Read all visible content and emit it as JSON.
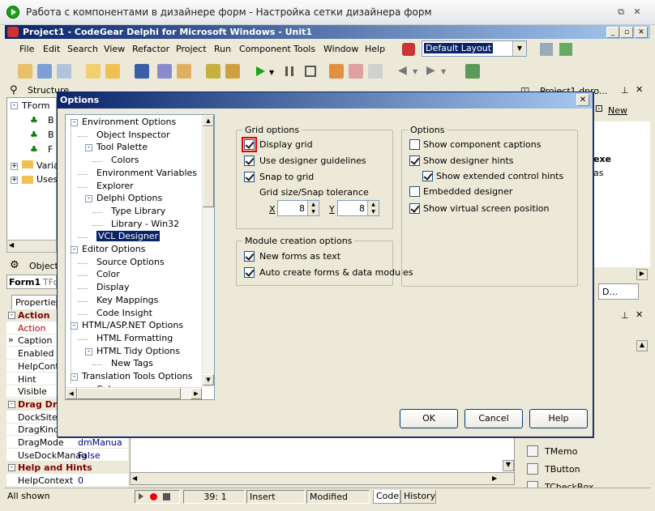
{
  "window": {
    "title": "Работа с компонентами в дизайнере форм - Настройка сетки дизайнера форм"
  },
  "ide": {
    "caption": "Project1 - CodeGear Delphi for Microsoft Windows - Unit1",
    "layout": "Default Layout"
  },
  "menu": [
    "File",
    "Edit",
    "Search",
    "View",
    "Refactor",
    "Project",
    "Run",
    "Component",
    "Tools",
    "Window",
    "Help"
  ],
  "structure": {
    "title": "Structure",
    "tree": [
      "TForm",
      "B",
      "B",
      "F",
      "Varia",
      "Uses"
    ]
  },
  "object_inspector": {
    "title": "Object",
    "object": "Form1",
    "object_type": "TFo",
    "tab": "Properties",
    "rows": [
      {
        "cat": true,
        "name": "Action"
      },
      {
        "name": "Action",
        "value": "",
        "red": true
      },
      {
        "name": "Caption",
        "value": "",
        "selected": true
      },
      {
        "name": "Enabled",
        "value": ""
      },
      {
        "name": "HelpConte",
        "value": ""
      },
      {
        "name": "Hint",
        "value": ""
      },
      {
        "name": "Visible",
        "value": ""
      },
      {
        "cat": true,
        "name": "Drag Dro"
      },
      {
        "name": "DockSite",
        "value": ""
      },
      {
        "name": "DragKind",
        "value": ""
      },
      {
        "name": "DragMode",
        "value": "dmManua"
      },
      {
        "name": "UseDockManag",
        "value": "False"
      },
      {
        "cat": true,
        "name": "Help and Hints"
      },
      {
        "name": "HelpContext",
        "value": "0"
      }
    ],
    "footer": "All shown"
  },
  "project_manager": {
    "title": "Project1.dpro...",
    "new_label": "New",
    "items": [
      "exe",
      "as"
    ],
    "tab": "D..."
  },
  "palette": [
    "TMemo",
    "TButton",
    "TCheckBox"
  ],
  "status": {
    "pos": "39:  1",
    "mode": "Insert",
    "state": "Modified",
    "tab_code": "Code",
    "tab_history": "History"
  },
  "dialog": {
    "title": "Options",
    "tree": [
      {
        "label": "Environment Options",
        "level": 0,
        "exp": "-"
      },
      {
        "label": "Object Inspector",
        "level": 1
      },
      {
        "label": "Tool Palette",
        "level": 1,
        "exp": "-"
      },
      {
        "label": "Colors",
        "level": 2
      },
      {
        "label": "Environment Variables",
        "level": 1
      },
      {
        "label": "Explorer",
        "level": 1
      },
      {
        "label": "Delphi Options",
        "level": 1,
        "exp": "-"
      },
      {
        "label": "Type Library",
        "level": 2
      },
      {
        "label": "Library - Win32",
        "level": 2
      },
      {
        "label": "VCL Designer",
        "level": 1,
        "selected": true
      },
      {
        "label": "Editor Options",
        "level": 0,
        "exp": "-"
      },
      {
        "label": "Source Options",
        "level": 1
      },
      {
        "label": "Color",
        "level": 1
      },
      {
        "label": "Display",
        "level": 1
      },
      {
        "label": "Key Mappings",
        "level": 1
      },
      {
        "label": "Code Insight",
        "level": 1
      },
      {
        "label": "HTML/ASP.NET Options",
        "level": 0,
        "exp": "-"
      },
      {
        "label": "HTML Formatting",
        "level": 1
      },
      {
        "label": "HTML Tidy Options",
        "level": 1,
        "exp": "-"
      },
      {
        "label": "New Tags",
        "level": 2
      },
      {
        "label": "Translation Tools Options",
        "level": 0,
        "exp": "-"
      },
      {
        "label": "Color",
        "level": 1
      }
    ],
    "grid_options": {
      "title": "Grid options",
      "display_grid": "Display grid",
      "guidelines": "Use designer guidelines",
      "snap": "Snap to grid",
      "size_label": "Grid size/Snap tolerance",
      "x_label": "X",
      "x_value": "8",
      "y_label": "Y",
      "y_value": "8"
    },
    "module_creation": {
      "title": "Module creation options",
      "new_forms_text": "New forms as text",
      "auto_create": "Auto create forms & data modules"
    },
    "options": {
      "title": "Options",
      "captions": "Show component captions",
      "hints": "Show designer hints",
      "extended_hints": "Show extended control hints",
      "embedded": "Embedded designer",
      "virtual_pos": "Show virtual screen position"
    },
    "buttons": {
      "ok": "OK",
      "cancel": "Cancel",
      "help": "Help"
    }
  }
}
